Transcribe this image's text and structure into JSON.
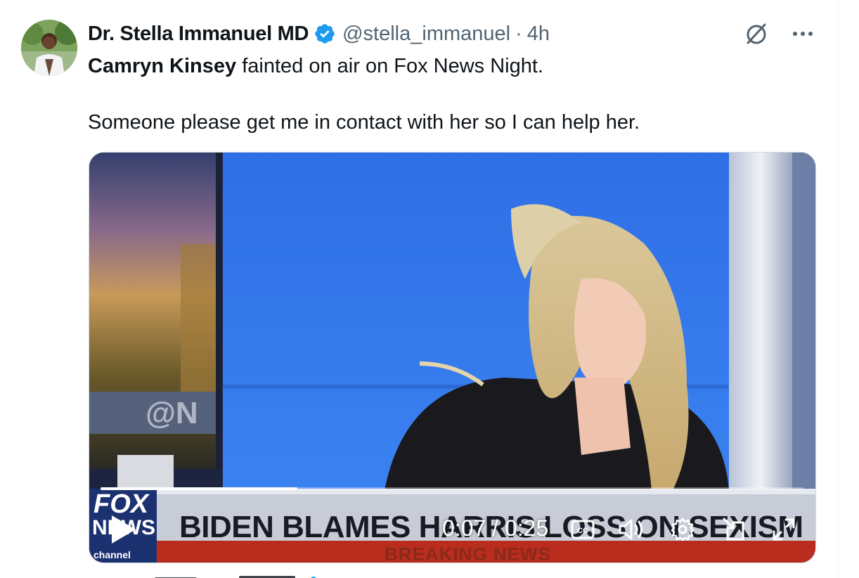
{
  "tweet": {
    "author_name": "Dr. Stella Immanuel MD",
    "handle": "@stella_immanuel",
    "separator": "·",
    "time": "4h",
    "mention": "Camryn Kinsey",
    "text_line1_rest": " fainted on air on Fox News Night.",
    "text_line2": "Someone please get me in contact with her so I can help her.",
    "verified_color": "#1d9bf0",
    "icons": {
      "grok": "grok-icon",
      "more": "more-icon"
    }
  },
  "video": {
    "chyron_headline": "BIDEN BLAMES HARRIS LOSS ON SEXISM",
    "chyron_subtitle": "BREAKING NEWS",
    "logo_top": "FOX",
    "logo_bottom": "NEWS",
    "logo_channel": "channel",
    "background_screen_text": "@N",
    "elapsed": "0:07",
    "time_separator": " / ",
    "duration": "0:25",
    "progress_fraction": 0.28,
    "icons": [
      "play-icon",
      "captions-icon",
      "volume-icon",
      "settings-icon",
      "pop-out-icon",
      "fullscreen-icon"
    ]
  }
}
